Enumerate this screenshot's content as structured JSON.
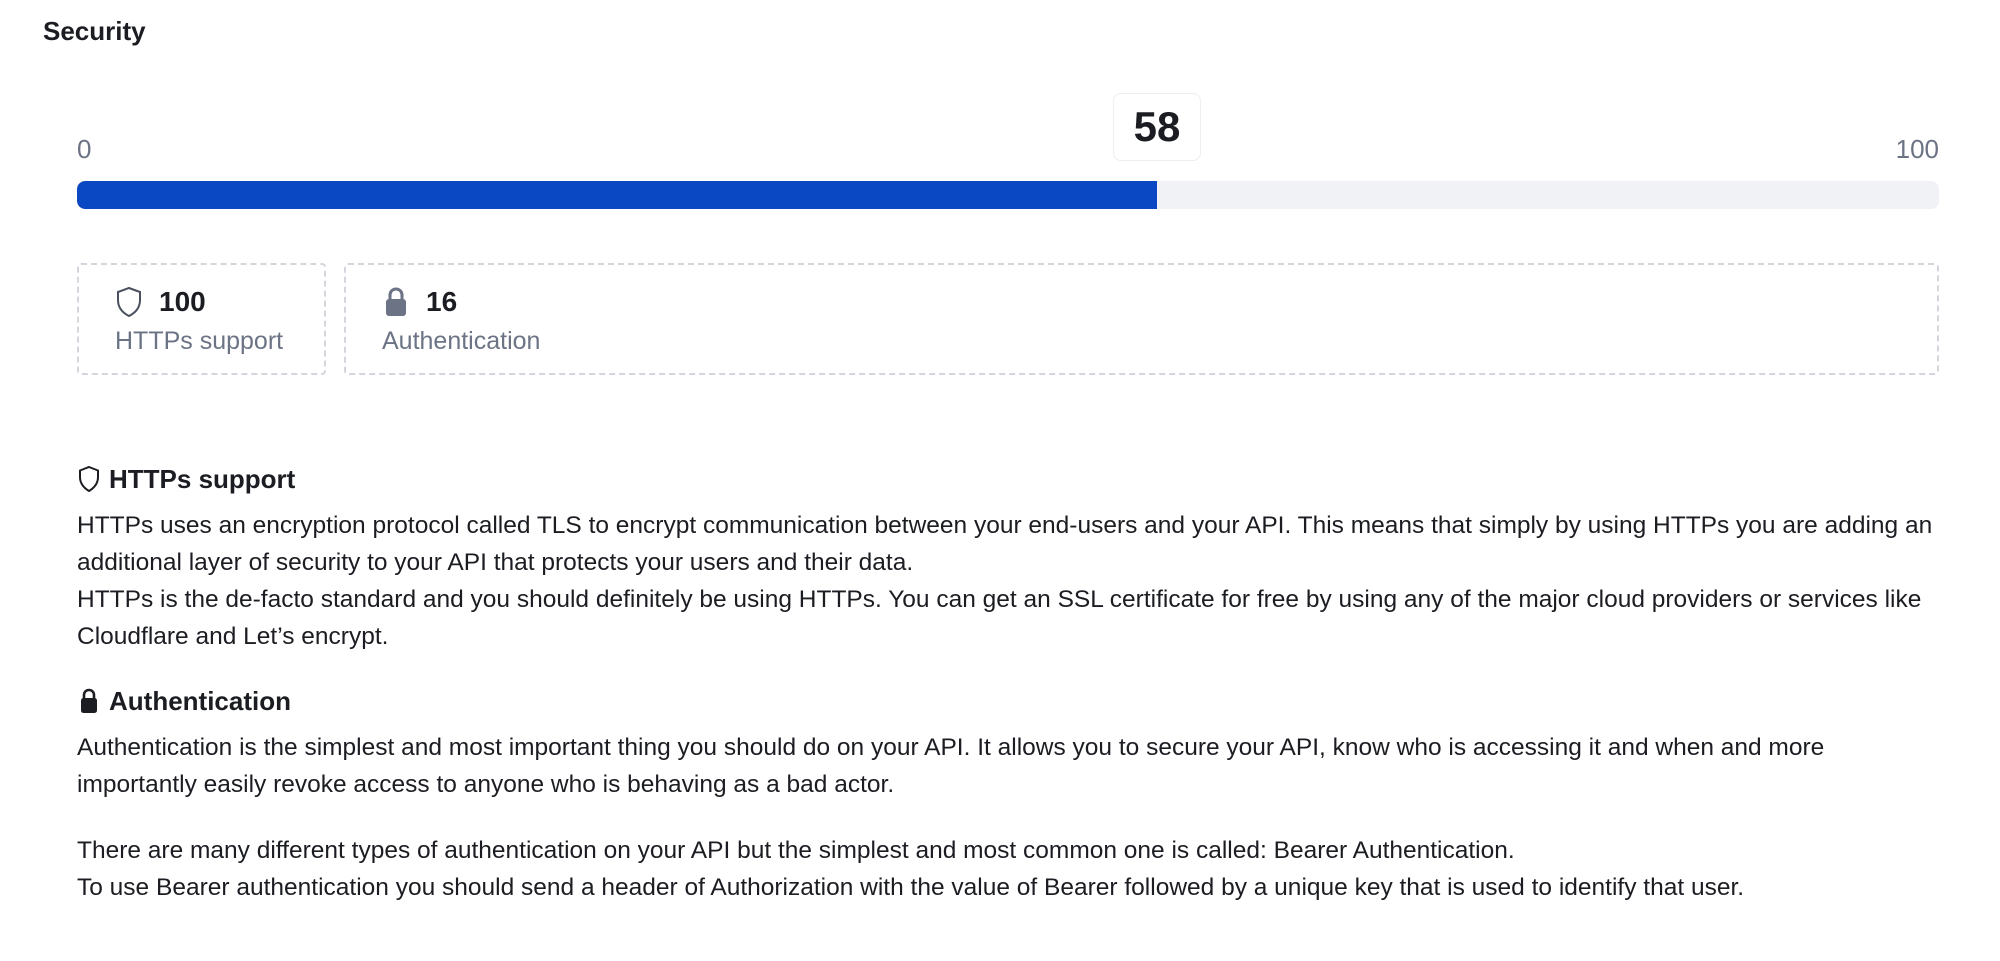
{
  "section": {
    "title": "Security"
  },
  "score": {
    "min_label": "0",
    "max_label": "100",
    "value_label": "58",
    "value": 58,
    "min": 0,
    "max": 100,
    "fill_color": "#0a47c2",
    "track_color": "#f1f2f6"
  },
  "stats": [
    {
      "icon": "shield-icon",
      "value": "100",
      "label": "HTTPs support"
    },
    {
      "icon": "lock-icon",
      "value": "16",
      "label": "Authentication"
    }
  ],
  "details": {
    "https": {
      "icon": "shield-icon",
      "title": "HTTPs support",
      "line1": "HTTPs uses an encryption protocol called TLS to encrypt communication between your end-users and your API. This means that simply by using HTTPs you are adding an additional layer of security to your API that protects your users and their data.",
      "line2": "HTTPs is the de-facto standard and you should definitely be using HTTPs. You can get an SSL certificate for free by using any of the major cloud providers or services like Cloudflare and Let’s encrypt."
    },
    "auth": {
      "icon": "lock-icon",
      "title": "Authentication",
      "line1": "Authentication is the simplest and most important thing you should do on your API. It allows you to secure your API, know who is accessing it and when and more importantly easily revoke access to anyone who is behaving as a bad actor.",
      "line2": "There are many different types of authentication on your API but the simplest and most common one is called: Bearer Authentication.",
      "line3": "To use Bearer authentication you should send a header of Authorization with the value of Bearer followed by a unique key that is used to identify that user."
    }
  }
}
